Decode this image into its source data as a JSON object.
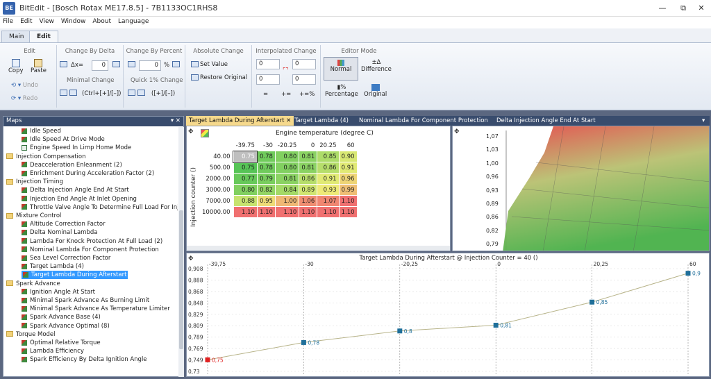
{
  "window": {
    "title": "BitEdit - [Bosch Rotax ME17.8.5] - 7B1133OC1RHS8",
    "icon_label": "BE"
  },
  "menu": [
    "File",
    "Edit",
    "View",
    "Window",
    "About",
    "Language"
  ],
  "ribbon_tabs": [
    "Main",
    "Edit"
  ],
  "ribbon": {
    "edit": {
      "title": "Edit",
      "copy": "Copy",
      "paste": "Paste",
      "undo": "Undo",
      "redo": "Redo"
    },
    "delta": {
      "title": "Change By Delta",
      "dx_label": "Δx=",
      "dx_value": "0",
      "minimal": "Minimal Change",
      "shortcut": "(Ctrl+[+]/[–])"
    },
    "percent": {
      "title": "Change By Percent",
      "value": "0",
      "unit": "%",
      "quick": "Quick 1% Change",
      "shortcut": "([+]/[–])"
    },
    "absolute": {
      "title": "Absolute Change",
      "set": "Set Value",
      "restore": "Restore Original"
    },
    "interp": {
      "title": "Interpolated Change",
      "values": [
        "0",
        "0",
        "0",
        "0"
      ],
      "ops": [
        "=",
        "+=",
        "+=%"
      ]
    },
    "mode": {
      "title": "Editor Mode",
      "normal": "Normal",
      "difference": "Difference",
      "percentage": "Percentage",
      "original": "Original"
    }
  },
  "maps": {
    "title": "Maps",
    "pin": "▾ ✕",
    "items": [
      {
        "label": "Idle Speed",
        "type": "map",
        "indent": 2
      },
      {
        "label": "Idle Speed At Drive Mode",
        "type": "map",
        "indent": 2
      },
      {
        "label": "Engine Speed In Limp Home Mode",
        "type": "tbl",
        "indent": 2
      },
      {
        "label": "Injection Compensation",
        "type": "fold",
        "indent": 1
      },
      {
        "label": "Deacceleration Enleanment (2)",
        "type": "map",
        "indent": 2
      },
      {
        "label": "Enrichment During Acceleration Factor (2)",
        "type": "map",
        "indent": 2
      },
      {
        "label": "Injection Timing",
        "type": "fold",
        "indent": 1
      },
      {
        "label": "Delta Injection Angle End At Start",
        "type": "map",
        "indent": 2
      },
      {
        "label": "Injection End Angle At Inlet Opening",
        "type": "map",
        "indent": 2
      },
      {
        "label": "Throttle Valve Angle To Determine Full Load For Inje",
        "type": "map",
        "indent": 2
      },
      {
        "label": "Mixture Control",
        "type": "fold",
        "indent": 1
      },
      {
        "label": "Altitude Correction Factor",
        "type": "map",
        "indent": 2
      },
      {
        "label": "Delta Nominal Lambda",
        "type": "map",
        "indent": 2
      },
      {
        "label": "Lambda For Knock Protection At Full Load (2)",
        "type": "map",
        "indent": 2
      },
      {
        "label": "Nominal Lambda For Component Protection",
        "type": "map",
        "indent": 2
      },
      {
        "label": "Sea Level Correction Factor",
        "type": "map",
        "indent": 2
      },
      {
        "label": "Target Lambda (4)",
        "type": "map",
        "indent": 2
      },
      {
        "label": "Target Lambda During Afterstart",
        "type": "map",
        "indent": 2,
        "selected": true
      },
      {
        "label": "Spark Advance",
        "type": "fold",
        "indent": 1
      },
      {
        "label": "Ignition Angle At Start",
        "type": "map",
        "indent": 2
      },
      {
        "label": "Minimal Spark Advance As Burning Limit",
        "type": "map",
        "indent": 2
      },
      {
        "label": "Minimal Spark Advance As Temperature Limiter",
        "type": "map",
        "indent": 2
      },
      {
        "label": "Spark Advance Base (4)",
        "type": "map",
        "indent": 2
      },
      {
        "label": "Spark Advance Optimal (8)",
        "type": "map",
        "indent": 2
      },
      {
        "label": "Torque Model",
        "type": "fold",
        "indent": 1
      },
      {
        "label": "Optimal Relative Torque",
        "type": "map",
        "indent": 2
      },
      {
        "label": "Lambda Efficiency",
        "type": "map",
        "indent": 2
      },
      {
        "label": "Spark Efficiency By Delta Ignition Angle",
        "type": "map",
        "indent": 2
      }
    ]
  },
  "doc_tabs": [
    "Target Lambda During Afterstart",
    "Target Lambda (4)",
    "Nominal Lambda For Component Protection",
    "Delta Injection Angle End At Start"
  ],
  "table": {
    "xaxis_title": "Engine temperature (degree C)",
    "yaxis_title": "Injection counter ()",
    "cols": [
      "-39.75",
      "-30",
      "-20.25",
      "0",
      "20.25",
      "60"
    ],
    "rows": [
      "40.00",
      "500.00",
      "2000.00",
      "3000.00",
      "7000.00",
      "10000.00"
    ],
    "cells": [
      [
        "0.75",
        "0.78",
        "0.80",
        "0.81",
        "0.85",
        "0.90"
      ],
      [
        "0.75",
        "0.78",
        "0.80",
        "0.81",
        "0.86",
        "0.91"
      ],
      [
        "0.77",
        "0.79",
        "0.81",
        "0.86",
        "0.91",
        "0.96"
      ],
      [
        "0.80",
        "0.82",
        "0.84",
        "0.89",
        "0.93",
        "0.99"
      ],
      [
        "0.88",
        "0.95",
        "1.00",
        "1.06",
        "1.07",
        "1.10"
      ],
      [
        "1.10",
        "1.10",
        "1.10",
        "1.10",
        "1.10",
        "1.10"
      ]
    ]
  },
  "surface": {
    "zticks": [
      "1,07",
      "1,03",
      "1,00",
      "0,96",
      "0,93",
      "0,89",
      "0,86",
      "0,82",
      "0,79"
    ]
  },
  "chart_data": {
    "type": "line",
    "title": "Target Lambda During Afterstart @ Injection Counter = 40 ()",
    "x": [
      -39.75,
      -30,
      -20.25,
      0,
      20.25,
      60
    ],
    "xtick_labels": [
      "-39,75",
      "-30",
      "-20,25",
      "0",
      "20,25",
      "60"
    ],
    "values": [
      0.75,
      0.78,
      0.8,
      0.81,
      0.85,
      0.9
    ],
    "data_labels": [
      "0,75",
      "0,78",
      "0,8",
      "0,81",
      "0,85",
      "0,9"
    ],
    "ytick_labels": [
      "0,908",
      "0,888",
      "0,868",
      "0,848",
      "0,829",
      "0,809",
      "0,789",
      "0,769",
      "0,749",
      "0,73"
    ],
    "ylim": [
      0.73,
      0.908
    ],
    "colors": {
      "line": "#b8b48a",
      "marker": "#1f6f9a",
      "first_marker": "#e02020"
    }
  }
}
